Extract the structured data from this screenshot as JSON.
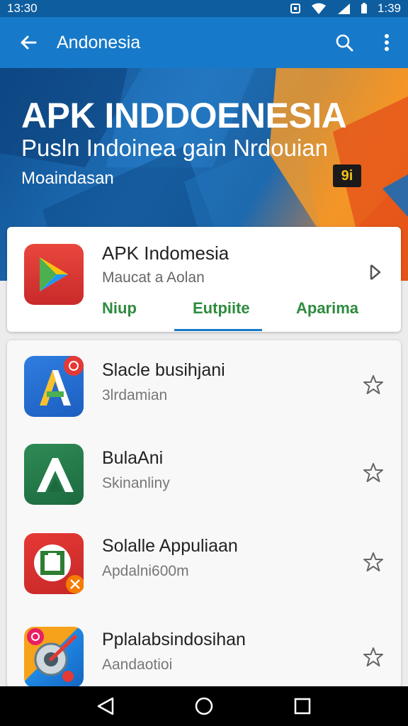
{
  "status_bar": {
    "time": "13:30",
    "clock_right": "1:39"
  },
  "app_bar": {
    "title": "Andonesia"
  },
  "banner": {
    "title": "APK INDDOENESIA",
    "subtitle": "Pusln Indoinea gain Nrdouian",
    "caption": "Moaindasan",
    "badge": "9i"
  },
  "featured": {
    "name": "APK Indomesia",
    "subtitle": "Maucat a Aolan",
    "tabs": [
      "Niup",
      "Eutpiite",
      "Aparima"
    ],
    "active_tab": 1
  },
  "apps": [
    {
      "title": "Slacle busihjani",
      "subtitle": "3lrdamian",
      "icon": "a-letter-icon"
    },
    {
      "title": "BulaAni",
      "subtitle": "Skinanliny",
      "icon": "green-a-icon"
    },
    {
      "title": "Solalle Appuliaan",
      "subtitle": "Apdalni600m",
      "icon": "red-ring-icon"
    },
    {
      "title": "Pplalabsindosihan",
      "subtitle": "Aandaotioi",
      "icon": "compass-icon"
    }
  ],
  "colors": {
    "app_bar": "#1679c9",
    "status_bar": "#0d5d9f",
    "tab_text": "#2e8b3e",
    "accent": "#1679c9"
  }
}
